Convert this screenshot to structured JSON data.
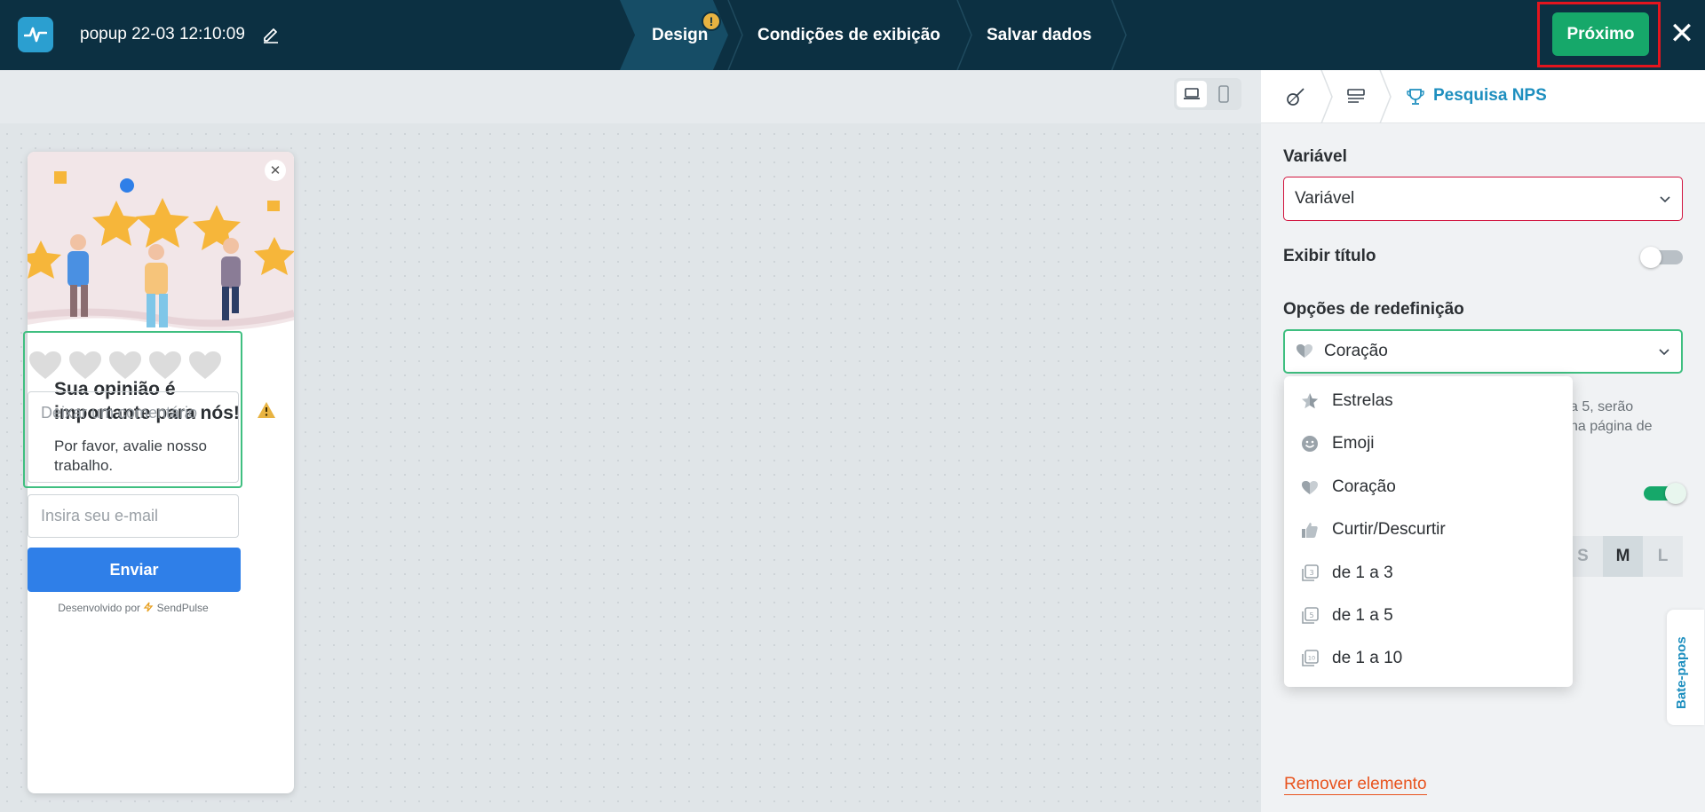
{
  "header": {
    "doc_title": "popup 22-03 12:10:09",
    "steps": [
      "Design",
      "Condições de exibição",
      "Salvar dados"
    ],
    "warning_mark": "!",
    "next_label": "Próximo",
    "close_label": "✕"
  },
  "popup": {
    "close_label": "✕",
    "title": "Sua opinião é importante para nós!",
    "subtitle": "Por favor, avalie nosso trabalho.",
    "comment_placeholder": "Deixar um comentário",
    "email_placeholder": "Insira seu e-mail",
    "send_label": "Enviar",
    "powered_by": "Desenvolvido por",
    "brand": "SendPulse",
    "rating_count": 5
  },
  "panel": {
    "title": "Pesquisa NPS",
    "variable_label": "Variável",
    "variable_value": "Variável",
    "show_title_label": "Exibir título",
    "show_title_on": false,
    "options_label": "Opções de redefinição",
    "options_value": "Coração",
    "hidden_note_1": "a 5, serão",
    "hidden_note_2": "na página de",
    "second_toggle_on": true,
    "sizes": [
      "S",
      "M",
      "L"
    ],
    "active_size": "M",
    "chat_tab": "Bate-papos",
    "remove_label": "Remover elemento"
  },
  "dropdown": {
    "items": [
      {
        "label": "Estrelas",
        "icon": "star-icon"
      },
      {
        "label": "Emoji",
        "icon": "smile-icon"
      },
      {
        "label": "Coração",
        "icon": "heart-icon"
      },
      {
        "label": "Curtir/Descurtir",
        "icon": "thumbs-icon"
      },
      {
        "label": "de 1 a 3",
        "icon": "scale-3-icon"
      },
      {
        "label": "de 1 a 5",
        "icon": "scale-5-icon"
      },
      {
        "label": "de 1 a 10",
        "icon": "scale-10-icon"
      }
    ]
  },
  "colors": {
    "header_bg": "#0c3042",
    "accent_green": "#16a86a",
    "highlight_red": "#e3151e",
    "link_blue": "#1e8fbf",
    "send_blue": "#2f7fe8",
    "remove_orange": "#e8541f"
  }
}
